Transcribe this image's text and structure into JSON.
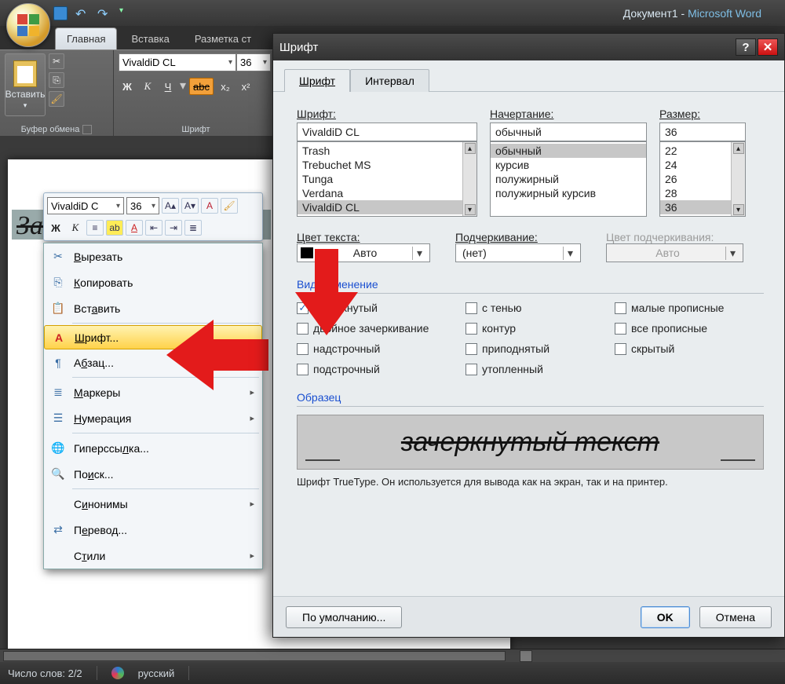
{
  "title": {
    "doc": "Документ1",
    "sep": " - ",
    "app": "Microsoft Word"
  },
  "ribbon_tabs": {
    "home": "Главная",
    "insert": "Вставка",
    "layout": "Разметка ст"
  },
  "clipboard_group": {
    "paste": "Вставить",
    "label": "Буфер обмена"
  },
  "font_group": {
    "name": "VivaldiD CL",
    "size": "36",
    "bold": "Ж",
    "italic": "К",
    "underline": "Ч",
    "strike": "abc",
    "sub": "x₂",
    "sup": "x²",
    "label": "Шрифт"
  },
  "page": {
    "selected_text": "Зачеркнутый"
  },
  "minibar": {
    "font": "VivaldiD C",
    "size": "36"
  },
  "context_menu": {
    "cut": "Вырезать",
    "copy": "Копировать",
    "paste": "Вставить",
    "font": "Шрифт...",
    "paragraph": "Абзац...",
    "bullets": "Маркеры",
    "numbering": "Нумерация",
    "hyperlink": "Гиперссылка...",
    "find": "Поиск...",
    "synonyms": "Синонимы",
    "translate": "Перевод...",
    "styles": "Стили"
  },
  "dialog": {
    "title": "Шрифт",
    "tabs": {
      "font": "Шрифт",
      "spacing": "Интервал"
    },
    "labels": {
      "font": "Шрифт:",
      "style": "Начертание:",
      "size": "Размер:",
      "text_color": "Цвет текста:",
      "underline": "Подчеркивание:",
      "underline_color": "Цвет подчеркивания:",
      "effects": "Видоизменение",
      "sample": "Образец"
    },
    "font_field": "VivaldiD CL",
    "font_list": [
      "Trash",
      "Trebuchet MS",
      "Tunga",
      "Verdana",
      "VivaldiD CL"
    ],
    "style_field": "обычный",
    "style_list": [
      "обычный",
      "курсив",
      "полужирный",
      "полужирный курсив"
    ],
    "size_field": "36",
    "size_list": [
      "22",
      "24",
      "26",
      "28",
      "36"
    ],
    "text_color": "Авто",
    "underline_style": "(нет)",
    "underline_color": "Авто",
    "effects": {
      "strike": "зачеркнутый",
      "dstrike": "двойное зачеркивание",
      "super": "надстрочный",
      "sub": "подстрочный",
      "shadow": "с тенью",
      "outline": "контур",
      "emboss": "приподнятый",
      "engrave": "утопленный",
      "smallcaps": "малые прописные",
      "allcaps": "все прописные",
      "hidden": "скрытый"
    },
    "preview_text": "зачеркнутый текст",
    "truetype_note": "Шрифт TrueType. Он используется для вывода как на экран, так и на принтер.",
    "buttons": {
      "default": "По умолчанию...",
      "ok": "OK",
      "cancel": "Отмена"
    }
  },
  "statusbar": {
    "words": "Число слов: 2/2",
    "lang": "русский"
  }
}
